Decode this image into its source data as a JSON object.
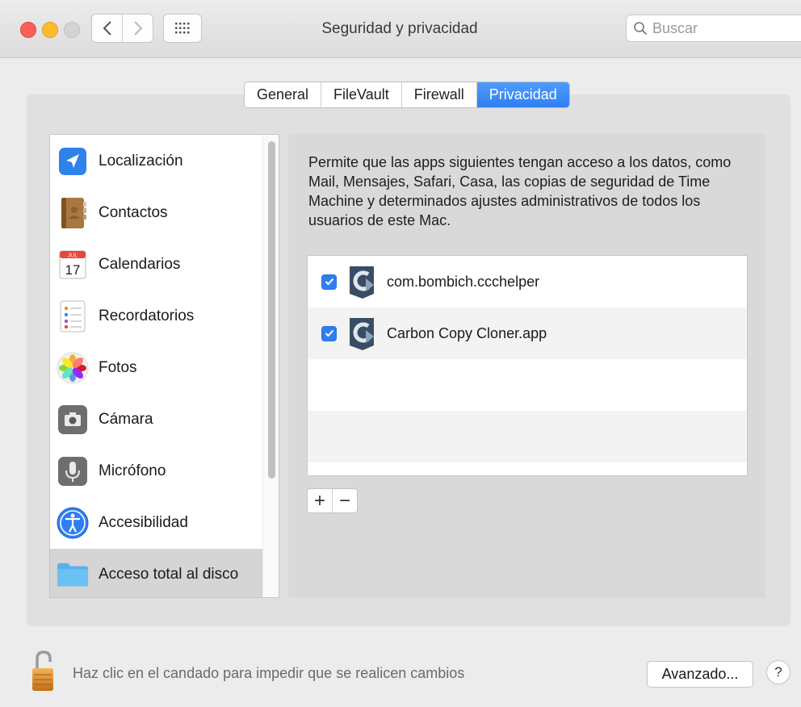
{
  "window": {
    "title": "Seguridad y privacidad",
    "search_placeholder": "Buscar"
  },
  "tabs": [
    {
      "label": "General",
      "active": false
    },
    {
      "label": "FileVault",
      "active": false
    },
    {
      "label": "Firewall",
      "active": false
    },
    {
      "label": "Privacidad",
      "active": true
    }
  ],
  "categories": [
    {
      "label": "Localización",
      "icon": "location-arrow-icon",
      "selected": false
    },
    {
      "label": "Contactos",
      "icon": "contacts-book-icon",
      "selected": false
    },
    {
      "label": "Calendarios",
      "icon": "calendar-icon",
      "selected": false
    },
    {
      "label": "Recordatorios",
      "icon": "reminders-icon",
      "selected": false
    },
    {
      "label": "Fotos",
      "icon": "photos-flower-icon",
      "selected": false
    },
    {
      "label": "Cámara",
      "icon": "camera-icon",
      "selected": false
    },
    {
      "label": "Micrófono",
      "icon": "microphone-icon",
      "selected": false
    },
    {
      "label": "Accesibilidad",
      "icon": "accessibility-icon",
      "selected": false
    },
    {
      "label": "Acceso total al disco",
      "icon": "folder-icon",
      "selected": true
    }
  ],
  "calendar_icon": {
    "month": "JUL",
    "day": "17"
  },
  "description": "Permite que las apps siguientes tengan acceso a los datos, como Mail, Mensajes, Safari, Casa, las copias de seguridad de Time Machine y determinados ajustes administrativos de todos los usuarios de este Mac.",
  "apps": [
    {
      "name": "com.bombich.ccchelper",
      "checked": true,
      "icon": "carbon-copy-cloner-icon"
    },
    {
      "name": "Carbon Copy Cloner.app",
      "checked": true,
      "icon": "carbon-copy-cloner-icon"
    }
  ],
  "list_controls": {
    "add": "+",
    "remove": "−"
  },
  "footer": {
    "lock_text": "Haz clic en el candado para impedir que se realicen cambios",
    "advanced_button": "Avanzado...",
    "help_button": "?"
  },
  "colors": {
    "accent": "#2f7ff2",
    "selected_row": "#d5d5d5"
  }
}
